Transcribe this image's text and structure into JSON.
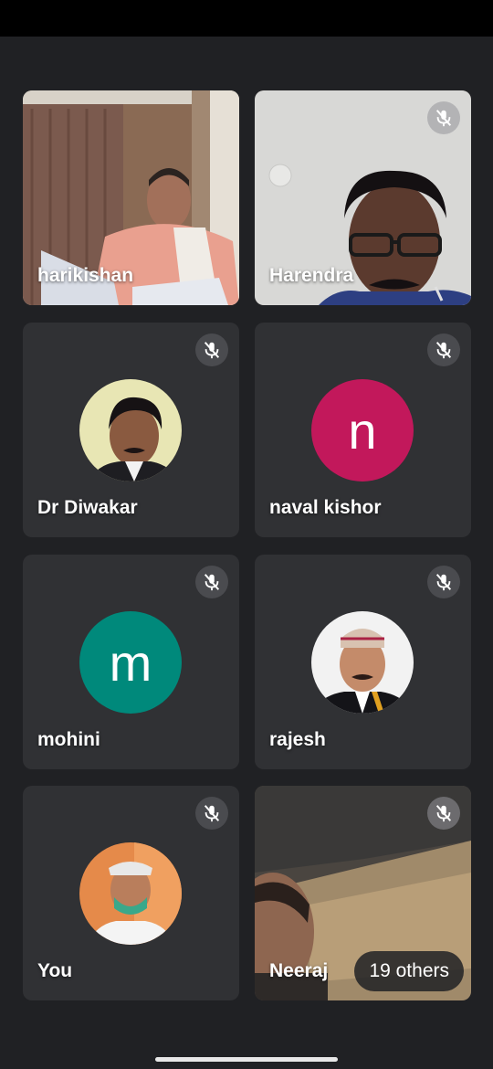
{
  "tiles": [
    {
      "name": "harikishan"
    },
    {
      "name": "Harendra"
    },
    {
      "name": "Dr Diwakar"
    },
    {
      "name": "naval kishor",
      "initial": "n"
    },
    {
      "name": "mohini",
      "initial": "m"
    },
    {
      "name": "rajesh"
    },
    {
      "name": "You"
    },
    {
      "name": "Neeraj"
    }
  ],
  "others_label": "19 others",
  "colors": {
    "background": "#202124",
    "tile": "#303134",
    "naval_avatar": "#c2185b",
    "mohini_avatar": "#00897b"
  },
  "icons": [
    "microphone-off-icon"
  ]
}
